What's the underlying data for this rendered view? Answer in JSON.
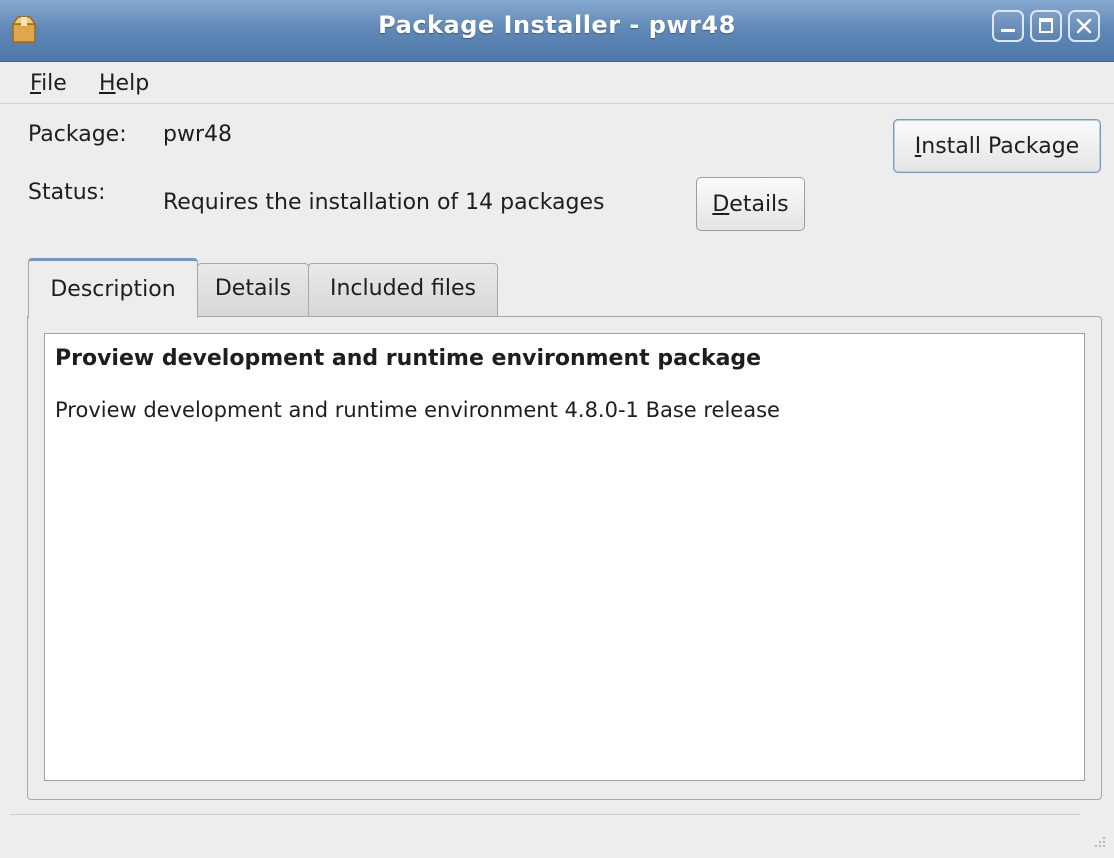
{
  "window": {
    "title": "Package Installer - pwr48",
    "app_icon": "package-icon",
    "controls": [
      "minimize-icon",
      "maximize-icon",
      "close-icon"
    ]
  },
  "menu": {
    "file": {
      "mnemonic": "F",
      "rest": "ile"
    },
    "help": {
      "mnemonic": "H",
      "rest": "elp"
    }
  },
  "info": {
    "package_label": "Package:",
    "package_value": "pwr48",
    "status_label": "Status:",
    "status_value": "Requires the installation of 14 packages"
  },
  "buttons": {
    "install": {
      "mnemonic": "I",
      "rest": "nstall Package"
    },
    "details": {
      "mnemonic": "D",
      "rest": "etails"
    }
  },
  "tabs": {
    "active": "Description",
    "items": [
      "Description",
      "Details",
      "Included files"
    ]
  },
  "description": {
    "title": "Proview development and runtime environment package",
    "body": "Proview development and runtime environment 4.8.0-1 Base release"
  },
  "colors": {
    "titlebar": "#5f88b7",
    "window_bg": "#ededed",
    "text": "#1e1e1e"
  }
}
